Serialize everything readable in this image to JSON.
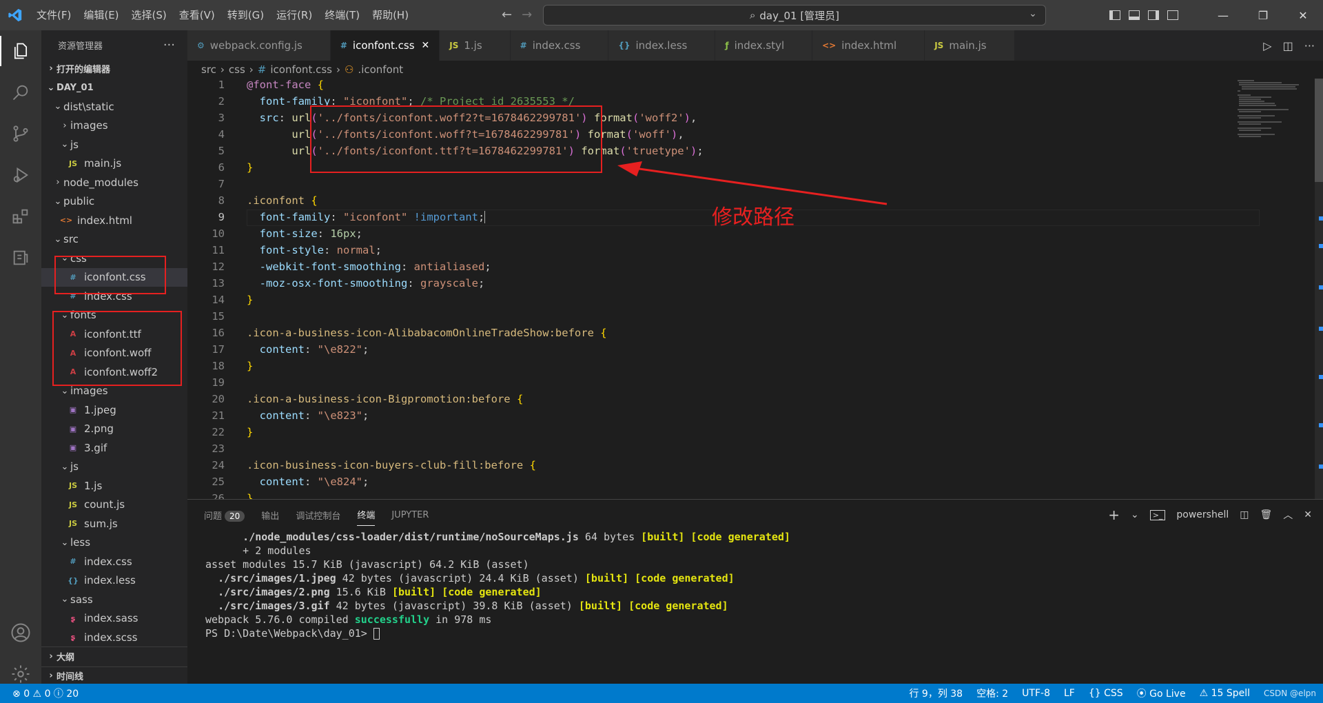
{
  "titlebar": {
    "menu": [
      "文件(F)",
      "编辑(E)",
      "选择(S)",
      "查看(V)",
      "转到(G)",
      "运行(R)",
      "终端(T)",
      "帮助(H)"
    ],
    "search_text": "day_01 [管理员]"
  },
  "sidebar": {
    "title": "资源管理器",
    "open_editors": "打开的编辑器",
    "root": "DAY_01",
    "outline": "大纲",
    "timeline": "时间线",
    "items": [
      {
        "label": "dist\\static",
        "depth": 1,
        "type": "folder",
        "open": true
      },
      {
        "label": "images",
        "depth": 2,
        "type": "folder",
        "open": false
      },
      {
        "label": "js",
        "depth": 2,
        "type": "folder",
        "open": true
      },
      {
        "label": "main.js",
        "depth": 3,
        "type": "js"
      },
      {
        "label": "node_modules",
        "depth": 1,
        "type": "folder",
        "open": false
      },
      {
        "label": "public",
        "depth": 1,
        "type": "folder",
        "open": true
      },
      {
        "label": "index.html",
        "depth": 2,
        "type": "html"
      },
      {
        "label": "src",
        "depth": 1,
        "type": "folder",
        "open": true
      },
      {
        "label": "css",
        "depth": 2,
        "type": "folder",
        "open": true
      },
      {
        "label": "iconfont.css",
        "depth": 3,
        "type": "css",
        "selected": true
      },
      {
        "label": "index.css",
        "depth": 3,
        "type": "css"
      },
      {
        "label": "fonts",
        "depth": 2,
        "type": "folder",
        "open": true
      },
      {
        "label": "iconfont.ttf",
        "depth": 3,
        "type": "font"
      },
      {
        "label": "iconfont.woff",
        "depth": 3,
        "type": "font"
      },
      {
        "label": "iconfont.woff2",
        "depth": 3,
        "type": "font"
      },
      {
        "label": "images",
        "depth": 2,
        "type": "folder",
        "open": true
      },
      {
        "label": "1.jpeg",
        "depth": 3,
        "type": "img"
      },
      {
        "label": "2.png",
        "depth": 3,
        "type": "img"
      },
      {
        "label": "3.gif",
        "depth": 3,
        "type": "img"
      },
      {
        "label": "js",
        "depth": 2,
        "type": "folder",
        "open": true
      },
      {
        "label": "1.js",
        "depth": 3,
        "type": "js"
      },
      {
        "label": "count.js",
        "depth": 3,
        "type": "js"
      },
      {
        "label": "sum.js",
        "depth": 3,
        "type": "js"
      },
      {
        "label": "less",
        "depth": 2,
        "type": "folder",
        "open": true
      },
      {
        "label": "index.css",
        "depth": 3,
        "type": "css"
      },
      {
        "label": "index.less",
        "depth": 3,
        "type": "less"
      },
      {
        "label": "sass",
        "depth": 2,
        "type": "folder",
        "open": true
      },
      {
        "label": "index.sass",
        "depth": 3,
        "type": "sass"
      },
      {
        "label": "index.scss",
        "depth": 3,
        "type": "sass"
      }
    ]
  },
  "tabs": [
    {
      "label": "webpack.config.js",
      "icon": "⚙",
      "color": "#519aba"
    },
    {
      "label": "iconfont.css",
      "icon": "#",
      "color": "#519aba",
      "active": true
    },
    {
      "label": "1.js",
      "icon": "JS",
      "color": "#cbcb41"
    },
    {
      "label": "index.css",
      "icon": "#",
      "color": "#519aba"
    },
    {
      "label": "index.less",
      "icon": "{}",
      "color": "#519aba"
    },
    {
      "label": "index.styl",
      "icon": "ƒ",
      "color": "#8dc149"
    },
    {
      "label": "index.html",
      "icon": "<>",
      "color": "#e37933"
    },
    {
      "label": "main.js",
      "icon": "JS",
      "color": "#cbcb41"
    }
  ],
  "breadcrumb": [
    "src",
    "css",
    "iconfont.css",
    ".iconfont"
  ],
  "annotation": "修改路径",
  "panel": {
    "tabs": [
      "问题",
      "输出",
      "调试控制台",
      "终端",
      "JUPYTER"
    ],
    "problems_count": "20",
    "shell": "powershell"
  },
  "status": {
    "errors": "0",
    "warnings": "0",
    "infos": "20",
    "position": "行 9，列 38",
    "spaces": "空格: 2",
    "encoding": "UTF-8",
    "eol": "LF",
    "language": "CSS",
    "golive": "Go Live",
    "spell": "15 Spell",
    "watermark": "CSDN @elpn"
  }
}
